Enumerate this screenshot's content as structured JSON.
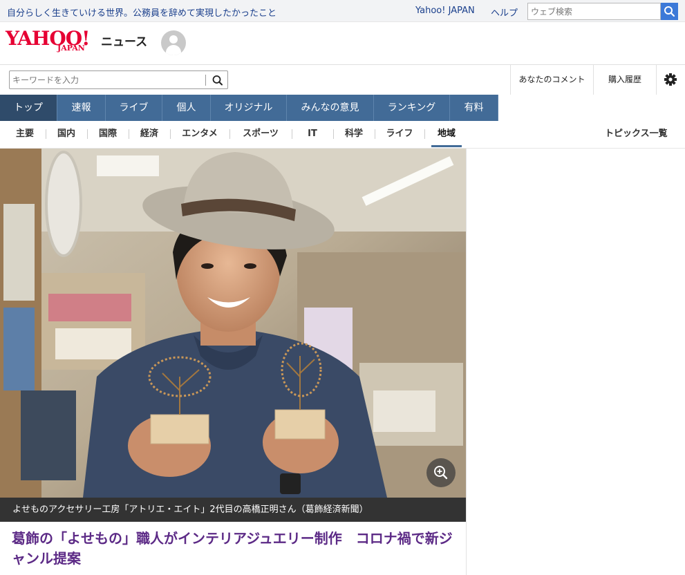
{
  "topbar": {
    "headline": "自分らしく生きていける世界。公務員を辞めて実現したかったこと",
    "yahoo_japan_link": "Yahoo! JAPAN",
    "help_link": "ヘルプ",
    "web_search_placeholder": "ウェブ検索",
    "search_icon": "search-icon"
  },
  "logo": {
    "brand": "YAHOO!",
    "japan": "JAPAN",
    "service": "ニュース"
  },
  "search": {
    "placeholder": "キーワードを入力",
    "my_comments": "あなたのコメント",
    "purchase_history": "購入履歴",
    "settings_icon": "gear-icon"
  },
  "main_nav": {
    "items": [
      {
        "label": "トップ"
      },
      {
        "label": "速報"
      },
      {
        "label": "ライブ"
      },
      {
        "label": "個人"
      },
      {
        "label": "オリジナル"
      },
      {
        "label": "みんなの意見"
      },
      {
        "label": "ランキング"
      },
      {
        "label": "有料"
      }
    ],
    "active": "トップ"
  },
  "sub_nav": {
    "items": [
      {
        "label": "主要"
      },
      {
        "label": "国内"
      },
      {
        "label": "国際"
      },
      {
        "label": "経済"
      },
      {
        "label": "エンタメ"
      },
      {
        "label": "スポーツ"
      },
      {
        "label": "IT"
      },
      {
        "label": "科学"
      },
      {
        "label": "ライフ"
      },
      {
        "label": "地域"
      }
    ],
    "active": "地域",
    "topics_link": "トピックス一覧"
  },
  "article": {
    "photo_caption": "よせものアクセサリー工房「アトリエ・エイト」2代目の高橋正明さん（葛飾経済新聞）",
    "title": "葛飾の「よせもの」職人がインテリアジュエリー制作　コロナ禍で新ジャンル提案",
    "zoom_icon": "zoom-in-icon"
  },
  "colors": {
    "nav_bg": "#426b97",
    "nav_active": "#2f4b6a",
    "brand_red": "#e60033",
    "title_purple": "#5c2a86",
    "link_blue": "#1a3f8c"
  }
}
